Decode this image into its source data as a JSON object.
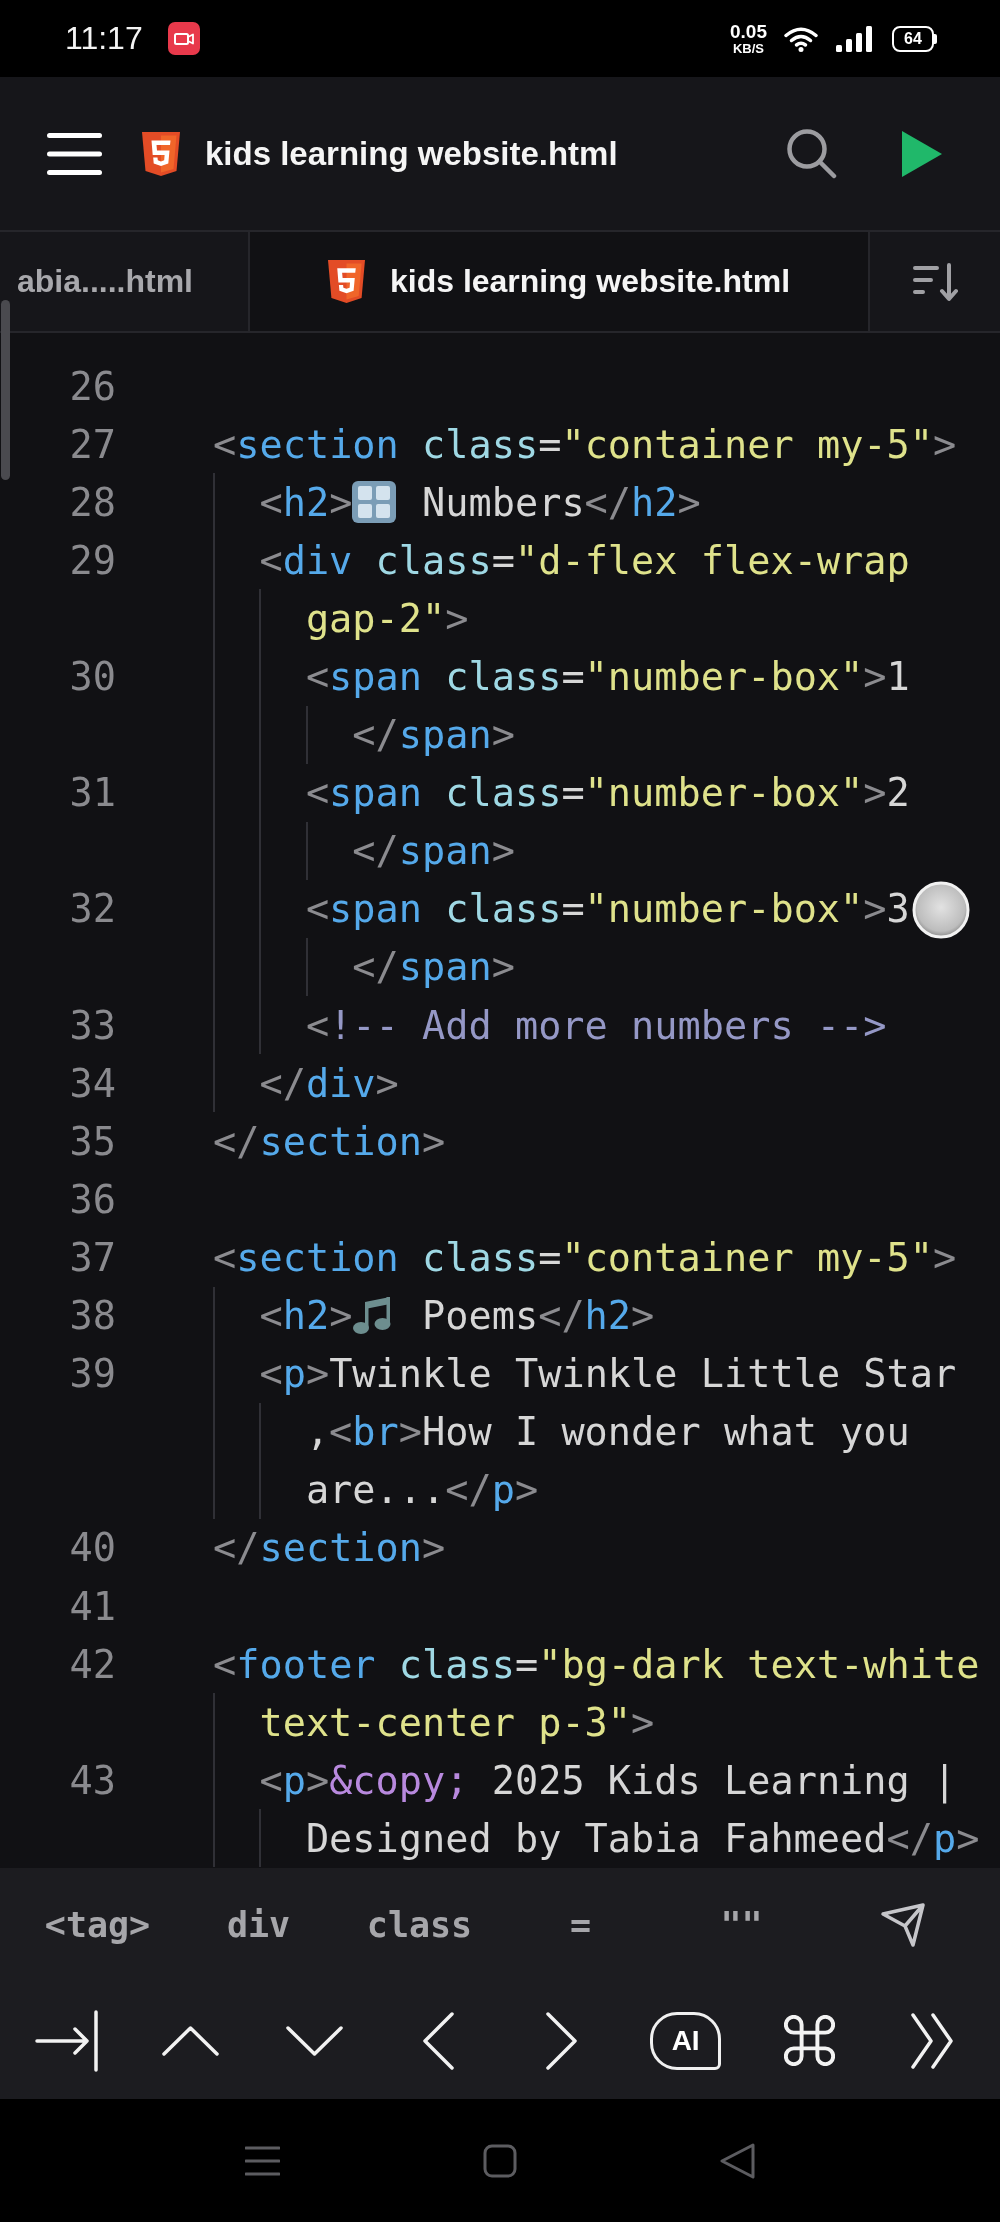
{
  "status_bar": {
    "time": "11:17",
    "net_speed": "0.05",
    "net_unit": "KB/S",
    "battery": "64"
  },
  "toolbar": {
    "title": "kids learning website.html"
  },
  "tabs": [
    {
      "label": "abia.....html",
      "selected": false
    },
    {
      "label": "kids learning website.html",
      "selected": true
    }
  ],
  "code": {
    "lines": [
      {
        "number": "26"
      },
      {
        "number": "27",
        "segments": [
          {
            "tokens": [
              {
                "kind": "punct",
                "text": "<"
              },
              {
                "kind": "tag",
                "text": "section"
              },
              {
                "kind": "attr",
                "text": " class"
              },
              {
                "kind": "text",
                "text": "="
              },
              {
                "kind": "string",
                "text": "\"container my-5\""
              },
              {
                "kind": "punct",
                "text": ">"
              }
            ]
          }
        ],
        "children": [
          {
            "number": "28",
            "segments": [
              {
                "tokens": [
                  {
                    "kind": "punct",
                    "text": "<"
                  },
                  {
                    "kind": "tag",
                    "text": "h2"
                  },
                  {
                    "kind": "punct",
                    "text": ">"
                  },
                  {
                    "kind": "keycap"
                  },
                  {
                    "kind": "text",
                    "text": " Numbers"
                  },
                  {
                    "kind": "punct",
                    "text": "</"
                  },
                  {
                    "kind": "tag",
                    "text": "h2"
                  },
                  {
                    "kind": "punct",
                    "text": ">"
                  }
                ]
              }
            ]
          },
          {
            "number": "29",
            "segments": [
              {
                "tokens": [
                  {
                    "kind": "punct",
                    "text": "<"
                  },
                  {
                    "kind": "tag",
                    "text": "div"
                  },
                  {
                    "kind": "attr",
                    "text": " class"
                  },
                  {
                    "kind": "text",
                    "text": "="
                  },
                  {
                    "kind": "string",
                    "text": "\"d-flex flex-wrap"
                  }
                ]
              },
              {
                "tokens": [
                  {
                    "kind": "string",
                    "text": "gap-2\""
                  },
                  {
                    "kind": "punct",
                    "text": ">"
                  }
                ]
              }
            ],
            "children": [
              {
                "number": "30",
                "segments": [
                  {
                    "tokens": [
                      {
                        "kind": "punct",
                        "text": "<"
                      },
                      {
                        "kind": "tag",
                        "text": "span"
                      },
                      {
                        "kind": "attr",
                        "text": " class"
                      },
                      {
                        "kind": "text",
                        "text": "="
                      },
                      {
                        "kind": "string",
                        "text": "\"number-box\""
                      },
                      {
                        "kind": "punct",
                        "text": ">"
                      },
                      {
                        "kind": "text",
                        "text": "1"
                      }
                    ]
                  },
                  {
                    "tokens": [
                      {
                        "kind": "punct",
                        "text": "</"
                      },
                      {
                        "kind": "tag",
                        "text": "span"
                      },
                      {
                        "kind": "punct",
                        "text": ">"
                      }
                    ]
                  }
                ]
              },
              {
                "number": "31",
                "segments": [
                  {
                    "tokens": [
                      {
                        "kind": "punct",
                        "text": "<"
                      },
                      {
                        "kind": "tag",
                        "text": "span"
                      },
                      {
                        "kind": "attr",
                        "text": " class"
                      },
                      {
                        "kind": "text",
                        "text": "="
                      },
                      {
                        "kind": "string",
                        "text": "\"number-box\""
                      },
                      {
                        "kind": "punct",
                        "text": ">"
                      },
                      {
                        "kind": "text",
                        "text": "2"
                      }
                    ]
                  },
                  {
                    "tokens": [
                      {
                        "kind": "punct",
                        "text": "</"
                      },
                      {
                        "kind": "tag",
                        "text": "span"
                      },
                      {
                        "kind": "punct",
                        "text": ">"
                      }
                    ]
                  }
                ]
              },
              {
                "number": "32",
                "segments": [
                  {
                    "tokens": [
                      {
                        "kind": "punct",
                        "text": "<"
                      },
                      {
                        "kind": "tag",
                        "text": "span"
                      },
                      {
                        "kind": "attr",
                        "text": " class"
                      },
                      {
                        "kind": "text",
                        "text": "="
                      },
                      {
                        "kind": "string",
                        "text": "\"number-box\""
                      },
                      {
                        "kind": "punct",
                        "text": ">"
                      },
                      {
                        "kind": "text",
                        "text": "3"
                      }
                    ]
                  },
                  {
                    "tokens": [
                      {
                        "kind": "punct",
                        "text": "</"
                      },
                      {
                        "kind": "tag",
                        "text": "span"
                      },
                      {
                        "kind": "punct",
                        "text": ">"
                      }
                    ]
                  }
                ]
              },
              {
                "number": "33",
                "segments": [
                  {
                    "tokens": [
                      {
                        "kind": "punct",
                        "text": "<"
                      },
                      {
                        "kind": "comment",
                        "text": "!-- Add more numbers -->"
                      }
                    ]
                  }
                ]
              }
            ]
          },
          {
            "number": "34",
            "segments": [
              {
                "tokens": [
                  {
                    "kind": "punct",
                    "text": "</"
                  },
                  {
                    "kind": "tag",
                    "text": "div"
                  },
                  {
                    "kind": "punct",
                    "text": ">"
                  }
                ]
              }
            ]
          }
        ]
      },
      {
        "number": "35",
        "segments": [
          {
            "tokens": [
              {
                "kind": "punct",
                "text": "</"
              },
              {
                "kind": "tag",
                "text": "section"
              },
              {
                "kind": "punct",
                "text": ">"
              }
            ]
          }
        ]
      },
      {
        "number": "36"
      },
      {
        "number": "37",
        "segments": [
          {
            "tokens": [
              {
                "kind": "punct",
                "text": "<"
              },
              {
                "kind": "tag",
                "text": "section"
              },
              {
                "kind": "attr",
                "text": " class"
              },
              {
                "kind": "text",
                "text": "="
              },
              {
                "kind": "string",
                "text": "\"container my-5\""
              },
              {
                "kind": "punct",
                "text": ">"
              }
            ]
          }
        ],
        "children": [
          {
            "number": "38",
            "segments": [
              {
                "tokens": [
                  {
                    "kind": "punct",
                    "text": "<"
                  },
                  {
                    "kind": "tag",
                    "text": "h2"
                  },
                  {
                    "kind": "punct",
                    "text": ">"
                  },
                  {
                    "kind": "note"
                  },
                  {
                    "kind": "text",
                    "text": " Poems"
                  },
                  {
                    "kind": "punct",
                    "text": "</"
                  },
                  {
                    "kind": "tag",
                    "text": "h2"
                  },
                  {
                    "kind": "punct",
                    "text": ">"
                  }
                ]
              }
            ]
          },
          {
            "number": "39",
            "segments": [
              {
                "tokens": [
                  {
                    "kind": "punct",
                    "text": "<"
                  },
                  {
                    "kind": "tag",
                    "text": "p"
                  },
                  {
                    "kind": "punct",
                    "text": ">"
                  },
                  {
                    "kind": "text",
                    "text": "Twinkle Twinkle Little Star"
                  }
                ]
              },
              {
                "tokens": [
                  {
                    "kind": "text",
                    "text": ","
                  },
                  {
                    "kind": "punct",
                    "text": "<"
                  },
                  {
                    "kind": "tag",
                    "text": "br"
                  },
                  {
                    "kind": "punct",
                    "text": ">"
                  },
                  {
                    "kind": "text",
                    "text": "How I wonder what you"
                  }
                ]
              },
              {
                "tokens": [
                  {
                    "kind": "text",
                    "text": "are..."
                  },
                  {
                    "kind": "punct",
                    "text": "</"
                  },
                  {
                    "kind": "tag",
                    "text": "p"
                  },
                  {
                    "kind": "punct",
                    "text": ">"
                  }
                ]
              }
            ]
          }
        ]
      },
      {
        "number": "40",
        "segments": [
          {
            "tokens": [
              {
                "kind": "punct",
                "text": "</"
              },
              {
                "kind": "tag",
                "text": "section"
              },
              {
                "kind": "punct",
                "text": ">"
              }
            ]
          }
        ]
      },
      {
        "number": "41"
      },
      {
        "number": "42",
        "segments": [
          {
            "tokens": [
              {
                "kind": "punct",
                "text": "<"
              },
              {
                "kind": "tag",
                "text": "footer"
              },
              {
                "kind": "attr",
                "text": " class"
              },
              {
                "kind": "text",
                "text": "="
              },
              {
                "kind": "string",
                "text": "\"bg-dark text-white"
              }
            ]
          },
          {
            "tokens": [
              {
                "kind": "string",
                "text": "text-center p-3\""
              },
              {
                "kind": "punct",
                "text": ">"
              }
            ]
          }
        ],
        "children": [
          {
            "number": "43",
            "segments": [
              {
                "tokens": [
                  {
                    "kind": "punct",
                    "text": "<"
                  },
                  {
                    "kind": "tag",
                    "text": "p"
                  },
                  {
                    "kind": "punct",
                    "text": ">"
                  },
                  {
                    "kind": "entity",
                    "text": "&copy;"
                  },
                  {
                    "kind": "text",
                    "text": " 2025 Kids Learning |"
                  }
                ]
              },
              {
                "tokens": [
                  {
                    "kind": "text",
                    "text": "Designed by Tabia Fahmeed"
                  },
                  {
                    "kind": "punct",
                    "text": "</"
                  },
                  {
                    "kind": "tag",
                    "text": "p"
                  },
                  {
                    "kind": "punct",
                    "text": ">"
                  }
                ]
              }
            ]
          }
        ]
      }
    ]
  },
  "symbol_bar": {
    "symbols": [
      "<tag>",
      "div",
      "class",
      "=",
      "\"\""
    ]
  },
  "key_bar": {
    "keys": [
      {
        "kind": "tab"
      },
      {
        "kind": "up"
      },
      {
        "kind": "down"
      },
      {
        "kind": "left"
      },
      {
        "kind": "right"
      },
      {
        "kind": "ai",
        "label": "AI"
      },
      {
        "kind": "command"
      },
      {
        "kind": "more"
      }
    ]
  }
}
